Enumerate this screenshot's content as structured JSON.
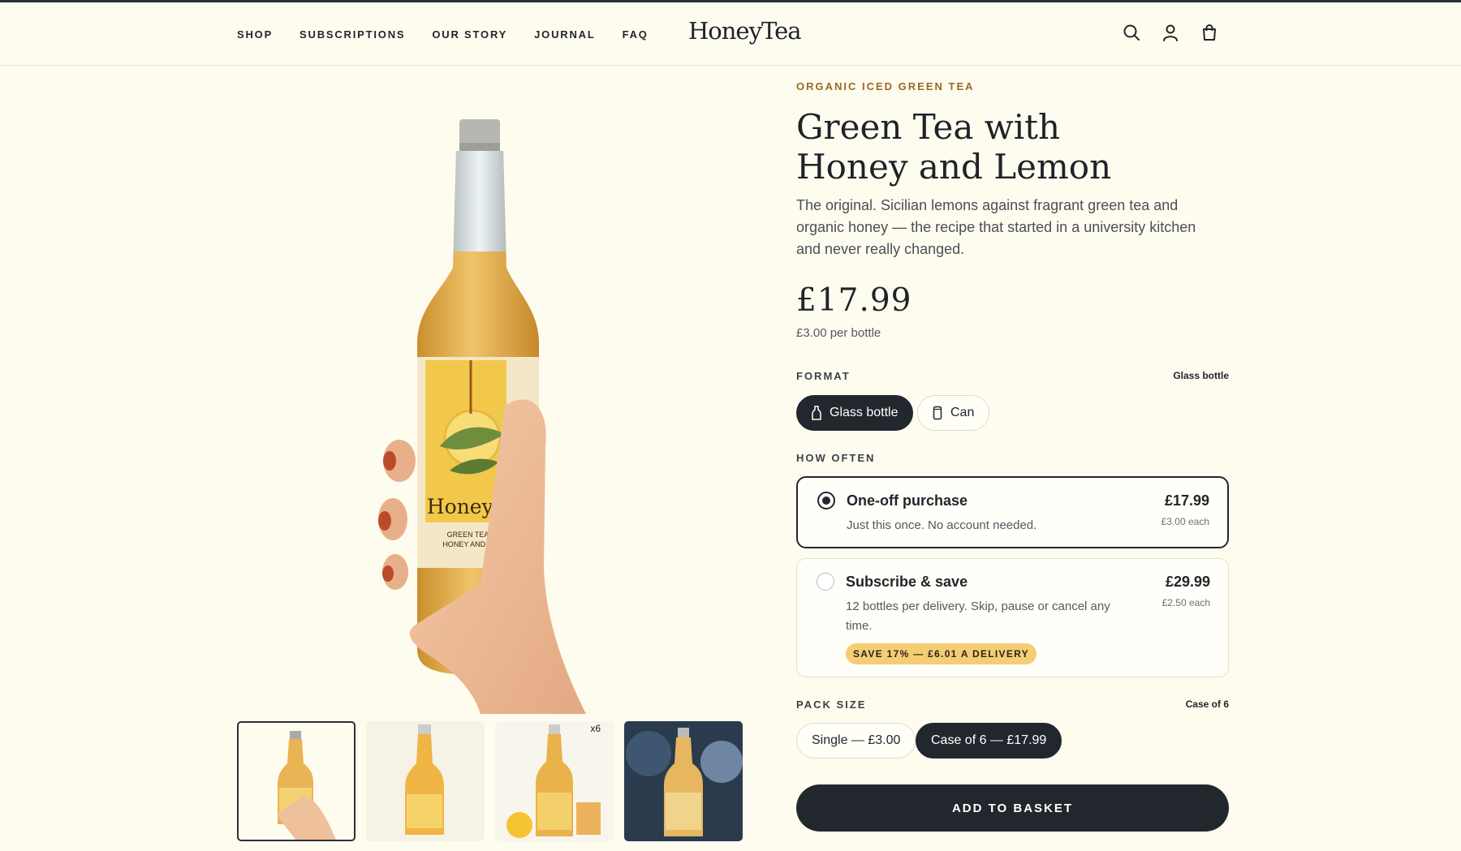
{
  "header": {
    "logo": "HoneyTea",
    "nav": [
      "SHOP",
      "SUBSCRIPTIONS",
      "OUR STORY",
      "JOURNAL",
      "FAQ"
    ],
    "icons": [
      "search-icon",
      "account-icon",
      "basket-icon"
    ]
  },
  "product": {
    "eyebrow": "ORGANIC ICED GREEN TEA",
    "title_line1": "Green Tea with",
    "title_line2": "Honey and Lemon",
    "description": "The original. Sicilian lemons against fragrant green tea and organic honey — the recipe that started in a university kitchen and never really changed.",
    "price": "£17.99",
    "unit_price": "£3.00 per bottle",
    "bottle_label": {
      "brand": "HoneyTea",
      "line1": "GREEN TEA WITH",
      "line2": "HONEY AND LEMON"
    }
  },
  "format": {
    "label": "FORMAT",
    "selected": "Glass bottle",
    "options": [
      "Glass bottle",
      "Can"
    ]
  },
  "frequency": {
    "label": "HOW OFTEN",
    "options": [
      {
        "title": "One-off purchase",
        "sub": "Just this once. No account needed.",
        "price": "£17.99",
        "each": "£3.00 each",
        "selected": true
      },
      {
        "title": "Subscribe & save",
        "sub": "12 bottles per delivery. Skip, pause or cancel any time.",
        "price": "£29.99",
        "each": "£2.50 each",
        "badge": "SAVE 17% — £6.01 A DELIVERY",
        "selected": false
      }
    ]
  },
  "pack": {
    "label": "PACK SIZE",
    "selected": "Case of 6",
    "options": [
      "Single — £3.00",
      "Case of 6 — £17.99"
    ]
  },
  "cta": "ADD TO BASKET",
  "thumbnails": {
    "count_tag": "x6"
  },
  "colors": {
    "background": "#fefcef",
    "dark": "#22272d",
    "accent": "#9a6a1e",
    "badge": "#f5cd74"
  }
}
